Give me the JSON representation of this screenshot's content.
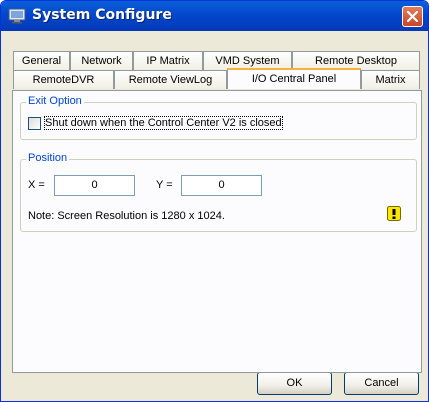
{
  "window": {
    "title": "System Configure"
  },
  "tabs_row1": [
    "General",
    "Network",
    "IP Matrix",
    "VMD System",
    "Remote Desktop"
  ],
  "tabs_row2": [
    "RemoteDVR",
    "Remote ViewLog",
    "I/O Central Panel",
    "Matrix"
  ],
  "active_tab": "I/O Central Panel",
  "exit_option": {
    "title": "Exit Option",
    "checkbox_label": "Shut down when the Control Center V2 is closed",
    "checked": false
  },
  "position": {
    "title": "Position",
    "x_label": "X =",
    "x_value": "0",
    "y_label": "Y =",
    "y_value": "0",
    "note": "Note: Screen Resolution is 1280 x 1024."
  },
  "icons": {
    "title": "app-icon",
    "close": "close-icon",
    "warning": "warning-icon"
  },
  "buttons": {
    "ok": "OK",
    "cancel": "Cancel"
  },
  "colors": {
    "titlebar": "#0447cc",
    "group_title": "#0046d5",
    "active_tab_accent": "#f7b339",
    "close_button": "#c7452a"
  }
}
